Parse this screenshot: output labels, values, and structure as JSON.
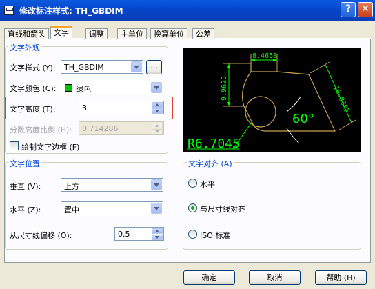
{
  "window": {
    "title": "修改标注样式: TH_GBDIM",
    "help_glyph": "?",
    "close_glyph": "✕"
  },
  "tabs": [
    {
      "label": "直线和箭头",
      "active": false
    },
    {
      "label": "文字",
      "active": true
    },
    {
      "label": "调整",
      "active": false
    },
    {
      "label": "主单位",
      "active": false
    },
    {
      "label": "换算单位",
      "active": false
    },
    {
      "label": "公差",
      "active": false
    }
  ],
  "text_appearance": {
    "legend": "文字外观",
    "style_label": "文字样式 (Y):",
    "style_value": "TH_GBDIM",
    "style_browse": "...",
    "color_label": "文字颜色 (C):",
    "color_value": "绿色",
    "color_swatch": "#00c000",
    "height_label": "文字高度 (T):",
    "height_value": "3",
    "fraction_label": "分数高度比例 (H):",
    "fraction_value": "0.714286",
    "frame_label": "绘制文字边框 (F)",
    "frame_checked": false
  },
  "text_position": {
    "legend": "文字位置",
    "vertical_label": "垂直 (V):",
    "vertical_value": "上方",
    "horizontal_label": "水平 (Z):",
    "horizontal_value": "置中",
    "offset_label": "从尺寸线偏移 (O):",
    "offset_value": "0.5"
  },
  "text_alignment": {
    "legend": "文字对齐 (A)",
    "options": [
      {
        "label": "水平",
        "selected": false
      },
      {
        "label": "与尺寸线对齐",
        "selected": true
      },
      {
        "label": "ISO 标准",
        "selected": false
      }
    ]
  },
  "preview": {
    "dim_top": "8.4658",
    "dim_left": "9.9625",
    "dim_right": "16.8305",
    "angle": "60°",
    "radius": "R6.7045",
    "colors": {
      "background": "#000000",
      "dimension": "#00ff00",
      "geometry": "#ffffff",
      "extension": "#c8a050"
    }
  },
  "buttons": {
    "ok": "确定",
    "cancel": "取消",
    "help": "帮助 (H)"
  },
  "colors": {
    "highlight_box": "#e04030",
    "group_legend": "#0046d5",
    "title_bar": "#0a5ae0"
  }
}
